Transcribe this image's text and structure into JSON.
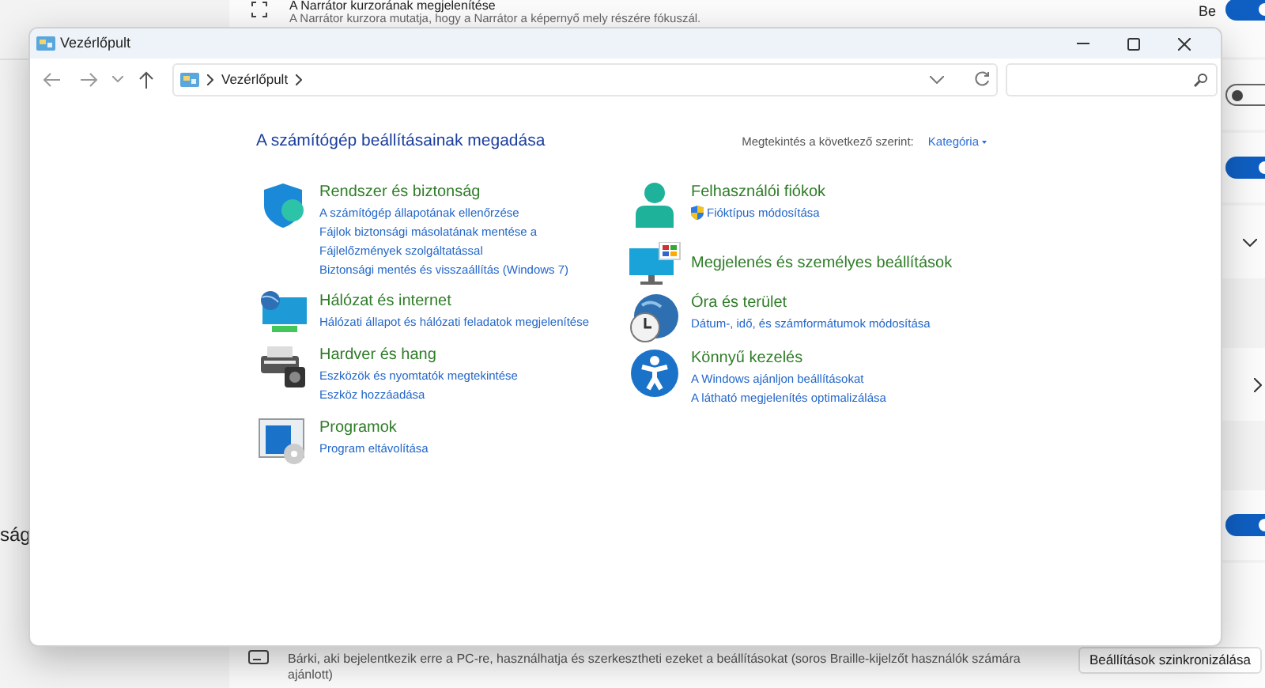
{
  "background": {
    "sidebar_text": "ság",
    "header_row": {
      "title": "A Narrátor kurzorának megjelenítése",
      "description": "A Narrátor kurzora mutatja, hogy a Narrátor a képernyő mely részére fókuszál.",
      "state_label": "Be",
      "on": true
    },
    "rows": [
      {
        "kind": "toggle",
        "on": false
      },
      {
        "kind": "toggle",
        "on": true
      },
      {
        "kind": "dropdown"
      },
      {
        "kind": "gap"
      },
      {
        "kind": "link"
      },
      {
        "kind": "gap"
      },
      {
        "kind": "toggle",
        "on": true
      }
    ],
    "footer_row": {
      "description": "Bárki, aki bejelentkezik erre a PC-re, használhatja és szerkesztheti ezeket a beállításokat (soros Braille-kijelzőt használók számára ajánlott)",
      "button": "Beállítások szinkronizálása"
    }
  },
  "window": {
    "title": "Vezérlőpult",
    "breadcrumb": [
      "Vezérlőpult"
    ],
    "heading": "A számítógép beállításainak megadása",
    "view_label": "Megtekintés a következő szerint:",
    "view_value": "Kategória",
    "columns": [
      [
        {
          "title": "Rendszer és biztonság",
          "links": [
            {
              "text": "A számítógép állapotának ellenőrzése"
            },
            {
              "text": "Fájlok biztonsági másolatának mentése a Fájlelőzmények szolgáltatással"
            },
            {
              "text": "Biztonsági mentés és visszaállítás (Windows 7)"
            }
          ]
        },
        {
          "title": "Hálózat és internet",
          "links": [
            {
              "text": "Hálózati állapot és hálózati feladatok megjelenítése"
            }
          ]
        },
        {
          "title": "Hardver és hang",
          "links": [
            {
              "text": "Eszközök és nyomtatók megtekintése"
            },
            {
              "text": "Eszköz hozzáadása"
            }
          ]
        },
        {
          "title": "Programok",
          "links": [
            {
              "text": "Program eltávolítása"
            }
          ]
        }
      ],
      [
        {
          "title": "Felhasználói fiókok",
          "links": [
            {
              "text": "Fióktípus módosítása",
              "shield": true
            }
          ]
        },
        {
          "title": "Megjelenés és személyes beállítások"
        },
        {
          "title": "Óra és terület",
          "links": [
            {
              "text": "Dátum-, idő, és számformátumok módosítása"
            }
          ]
        },
        {
          "title": "Könnyű kezelés",
          "links": [
            {
              "text": "A Windows ajánljon beállításokat"
            },
            {
              "text": "A látható megjelenítés optimalizálása"
            }
          ]
        }
      ]
    ]
  }
}
